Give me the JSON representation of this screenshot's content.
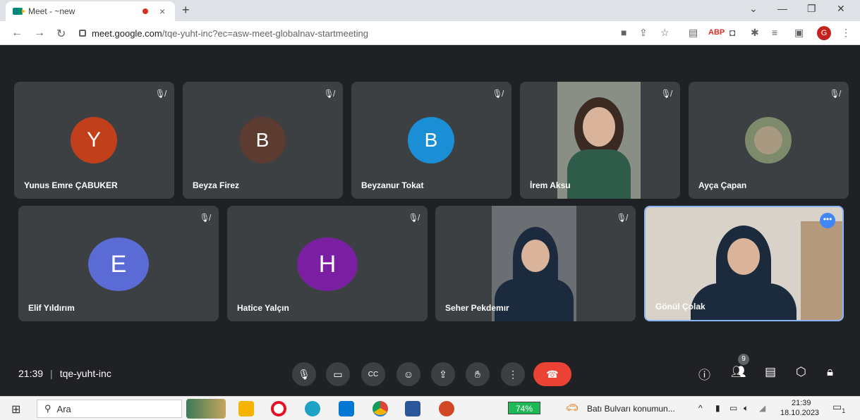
{
  "browser": {
    "tab_title": "Meet - ~new",
    "tab_close": "×",
    "new_tab": "+",
    "url_host": "meet.google.com",
    "url_path": "/tqe-yuht-inc?ec=asw-meet-globalnav-startmeeting",
    "profile_initial": "G",
    "extension_abp": "ABP"
  },
  "participants": [
    {
      "name": "Yunus Emre ÇABUKER",
      "initial": "Y",
      "color": "#c1401b"
    },
    {
      "name": "Beyza Firez",
      "initial": "B",
      "color": "#5c3b30"
    },
    {
      "name": "Beyzanur Tokat",
      "initial": "B",
      "color": "#1a8fd6"
    },
    {
      "name": "İrem Aksu"
    },
    {
      "name": "Ayça Çapan"
    },
    {
      "name": "Elif Yıldırım",
      "initial": "E",
      "color": "#5b6bd6"
    },
    {
      "name": "Hatice Yalçın",
      "initial": "H",
      "color": "#7b1fa2"
    },
    {
      "name": "Seher Pekdemır"
    },
    {
      "name": "Gönül Çolak"
    }
  ],
  "meeting": {
    "time": "21:39",
    "code": "tqe-yuht-inc",
    "participant_count": "9"
  },
  "taskbar": {
    "search_placeholder": "Ara",
    "battery": "74%",
    "notification_text": "Batı Bulvarı konumun...",
    "clock_time": "21:39",
    "clock_date": "18.10.2023",
    "notif_count": "1"
  }
}
